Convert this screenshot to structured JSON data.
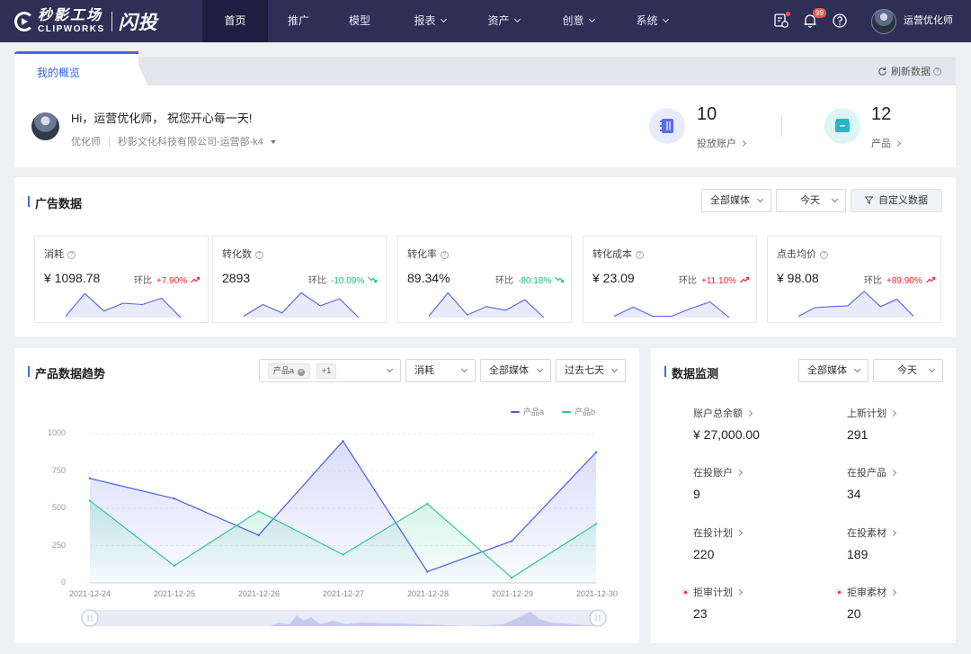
{
  "topbar": {
    "logo_cn": "秒影工场",
    "logo_en": "CLIPWORKS",
    "logo_sub": "闪投",
    "nav": [
      {
        "label": "首页",
        "has_caret": false,
        "active": true
      },
      {
        "label": "推广",
        "has_caret": false,
        "active": false
      },
      {
        "label": "模型",
        "has_caret": false,
        "active": false
      },
      {
        "label": "报表",
        "has_caret": true,
        "active": false
      },
      {
        "label": "资产",
        "has_caret": true,
        "active": false
      },
      {
        "label": "创意",
        "has_caret": true,
        "active": false
      },
      {
        "label": "系统",
        "has_caret": true,
        "active": false
      }
    ],
    "notification_badge": "99",
    "user_name": "运营优化师"
  },
  "overview": {
    "tab_label": "我的概览",
    "refresh_label": "刷新数据",
    "greeting": "Hi，运营优化师， 祝您开心每一天!",
    "role": "优化师",
    "company": "秒影文化科技有限公司-运营部-k4",
    "stats": [
      {
        "value": "10",
        "label": "投放账户",
        "icon": "account-book-icon",
        "color": "#5b6cf0"
      },
      {
        "value": "12",
        "label": "产品",
        "icon": "product-box-icon",
        "color": "#22b8c8"
      }
    ]
  },
  "ad_data": {
    "title": "广告数据",
    "media_select": "全部媒体",
    "date_select": "今天",
    "custom_button": "自定义数据",
    "ring_label": "环比",
    "cards": [
      {
        "label": "消耗",
        "value": "¥ 1098.78",
        "change": "+7.90%",
        "direction": "up",
        "spark": [
          0.05,
          0.92,
          0.25,
          0.55,
          0.5,
          0.74,
          0.0
        ]
      },
      {
        "label": "转化数",
        "value": "2893",
        "change": "-10.09%",
        "direction": "down",
        "spark": [
          0.05,
          0.5,
          0.18,
          0.95,
          0.45,
          0.72,
          0.0
        ]
      },
      {
        "label": "转化率",
        "value": "89.34%",
        "change": "-80.18%",
        "direction": "down",
        "spark": [
          0.05,
          0.95,
          0.1,
          0.42,
          0.28,
          0.68,
          0.0
        ]
      },
      {
        "label": "转化成本",
        "value": "¥ 23.09",
        "change": "+11.10%",
        "direction": "up",
        "spark": [
          0.05,
          0.4,
          0.05,
          0.05,
          0.35,
          0.6,
          0.0
        ]
      },
      {
        "label": "点击均价",
        "value": "¥ 98.08",
        "change": "+89.90%",
        "direction": "up",
        "spark": [
          0.05,
          0.38,
          0.42,
          0.45,
          1.0,
          0.42,
          0.7,
          0.05
        ]
      }
    ]
  },
  "trend": {
    "title": "产品数据趋势",
    "product_tags": [
      "产品a",
      "+1"
    ],
    "metric_select": "消耗",
    "media_select": "全部媒体",
    "range_select": "过去七天",
    "chart_data": {
      "type": "area",
      "categories": [
        "2021-12-24",
        "2021-12-25",
        "2021-12-26",
        "2021-12-27",
        "2021-12-28",
        "2021-12-29",
        "2021-12-30"
      ],
      "series": [
        {
          "name": "产品a",
          "values": [
            700,
            565,
            320,
            950,
            75,
            280,
            875
          ],
          "color": "#4a5cf0"
        },
        {
          "name": "产品b",
          "values": [
            550,
            115,
            480,
            190,
            530,
            35,
            395
          ],
          "color": "#2ec98f"
        }
      ],
      "ylim": [
        0,
        1000
      ],
      "yticks": [
        0,
        250,
        500,
        750,
        1000
      ],
      "legend": "top-right",
      "grid": true
    }
  },
  "monitor": {
    "title": "数据监测",
    "media_select": "全部媒体",
    "date_select": "今天",
    "items": [
      {
        "label": "账户总余额",
        "value": "¥ 27,000.00",
        "alert": false
      },
      {
        "label": "上新计划",
        "value": "291",
        "alert": false
      },
      {
        "label": "在投账户",
        "value": "9",
        "alert": false
      },
      {
        "label": "在投产品",
        "value": "34",
        "alert": false
      },
      {
        "label": "在投计划",
        "value": "220",
        "alert": false
      },
      {
        "label": "在投素材",
        "value": "189",
        "alert": false
      },
      {
        "label": "拒审计划",
        "value": "23",
        "alert": true
      },
      {
        "label": "拒审素材",
        "value": "20",
        "alert": true
      }
    ]
  }
}
